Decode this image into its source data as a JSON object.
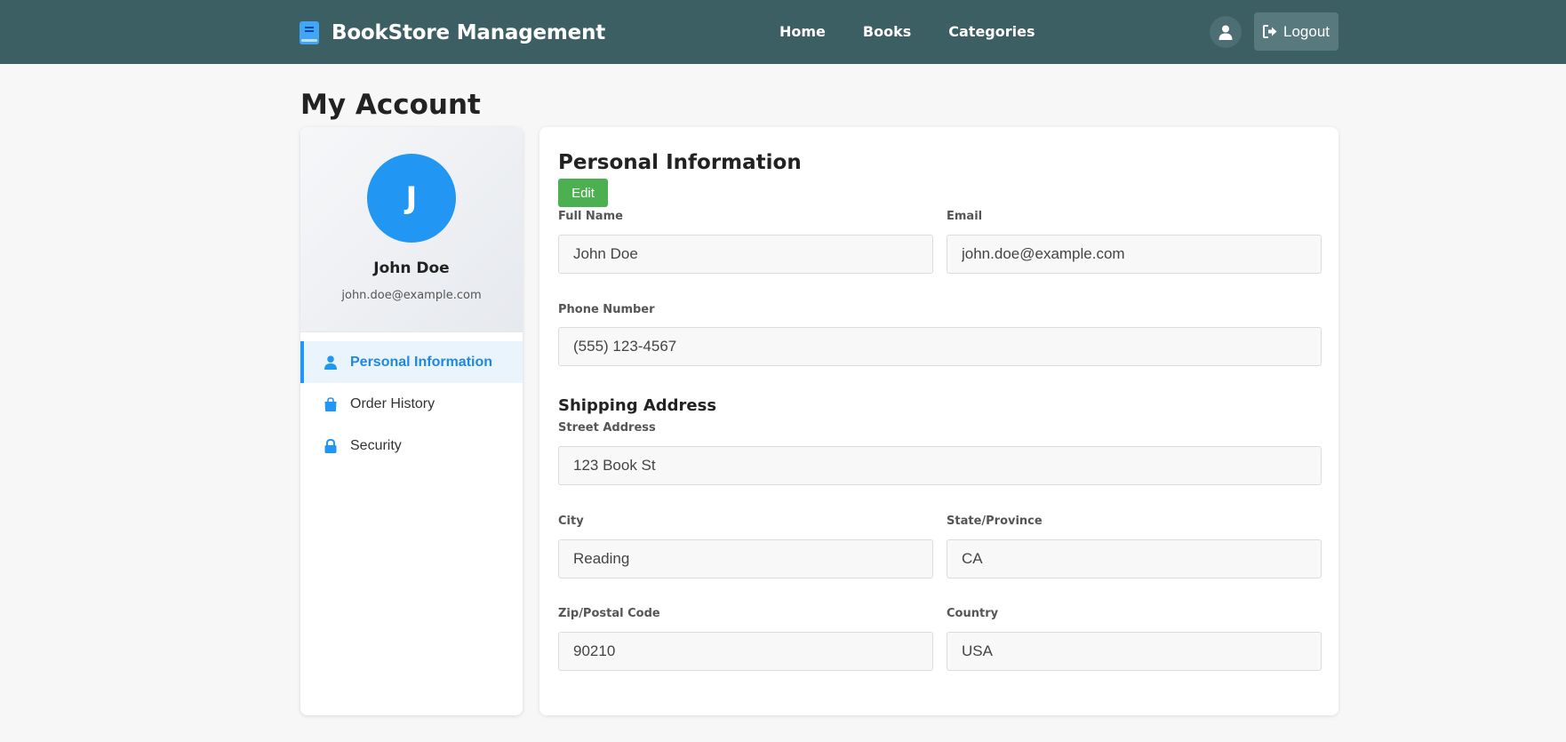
{
  "navbar": {
    "brand": "BookStore Management",
    "links": [
      "Home",
      "Books",
      "Categories"
    ],
    "logout": "Logout"
  },
  "page": {
    "title": "My Account"
  },
  "profile": {
    "initial": "J",
    "name": "John Doe",
    "email": "john.doe@example.com"
  },
  "menu": {
    "items": [
      {
        "label": "Personal Information",
        "icon": "user-icon",
        "active": true
      },
      {
        "label": "Order History",
        "icon": "shopping-bag-icon",
        "active": false
      },
      {
        "label": "Security",
        "icon": "lock-icon",
        "active": false
      }
    ]
  },
  "personal": {
    "title": "Personal Information",
    "edit": "Edit",
    "full_name": {
      "label": "Full Name",
      "value": "John Doe"
    },
    "email": {
      "label": "Email",
      "value": "john.doe@example.com"
    },
    "phone": {
      "label": "Phone Number",
      "value": "(555) 123-4567"
    }
  },
  "shipping": {
    "title": "Shipping Address",
    "street": {
      "label": "Street Address",
      "value": "123 Book St"
    },
    "city": {
      "label": "City",
      "value": "Reading"
    },
    "state": {
      "label": "State/Province",
      "value": "CA"
    },
    "zip": {
      "label": "Zip/Postal Code",
      "value": "90210"
    },
    "country": {
      "label": "Country",
      "value": "USA"
    }
  },
  "colors": {
    "navbar": "#3c5f63",
    "accent": "#2196f3",
    "edit_button": "#4caf50"
  }
}
